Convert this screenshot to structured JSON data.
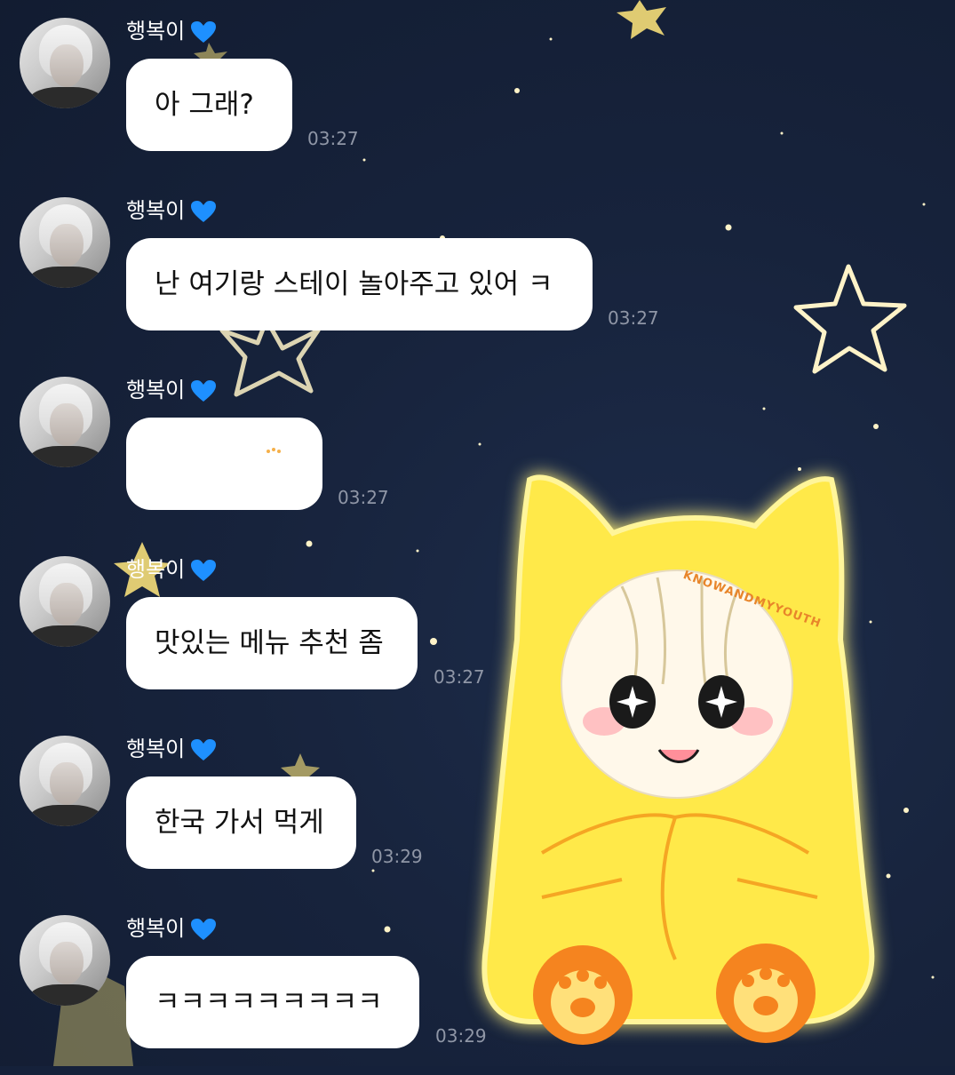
{
  "chat": {
    "messages": [
      {
        "sender": "행복이",
        "text": "아 그래?",
        "time": "03:27"
      },
      {
        "sender": "행복이",
        "text": "난 여기랑 스테이 놀아주고 있어 ㅋ",
        "time": "03:27"
      },
      {
        "sender": "행복이",
        "text": "",
        "time": "03:27"
      },
      {
        "sender": "행복이",
        "text": "맛있는 메뉴 추천 좀",
        "time": "03:27"
      },
      {
        "sender": "행복이",
        "text": "한국 가서 먹게",
        "time": "03:29"
      },
      {
        "sender": "행복이",
        "text": "ㅋㅋㅋㅋㅋㅋㅋㅋㅋ",
        "time": "03:29"
      }
    ],
    "heart_icon": "blue-heart-icon",
    "heart_color": "#1e90ff"
  },
  "sticker": {
    "watermark": "KNOWANDMYYOUTH",
    "colors": {
      "hood": "#ffe94a",
      "paw": "#f5841f",
      "glow": "#fff59a"
    }
  },
  "background": {
    "color": "#15213a",
    "star_color": "#fff1b8"
  }
}
